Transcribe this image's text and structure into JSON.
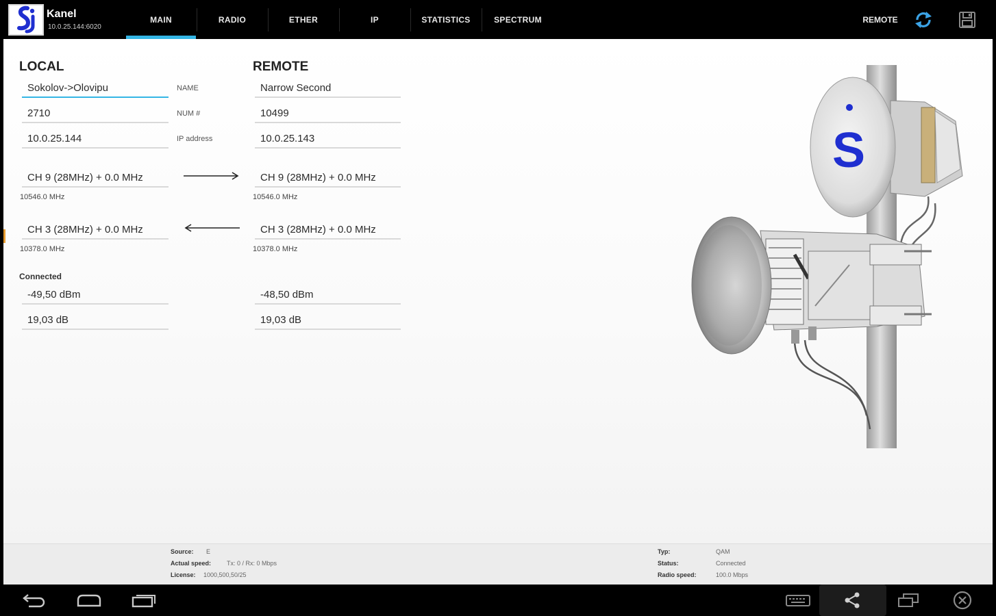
{
  "app": {
    "title": "Kanel",
    "subtitle": "10.0.25.144:6020"
  },
  "tabs": [
    "MAIN",
    "RADIO",
    "ETHER",
    "IP",
    "STATISTICS",
    "SPECTRUM"
  ],
  "active_tab": "MAIN",
  "actions": {
    "remote_label": "REMOTE",
    "icons": [
      "refresh-icon",
      "save-icon"
    ]
  },
  "local": {
    "heading": "LOCAL",
    "name": "Sokolov->Olovipu",
    "num": "2710",
    "ip": "10.0.25.144",
    "tx_channel": "CH 9 (28MHz) + 0.0 MHz",
    "tx_freq": "10546.0 MHz",
    "rx_channel": "CH 3 (28MHz) + 0.0 MHz",
    "rx_freq": "10378.0 MHz",
    "rssi": "-49,50 dBm",
    "snr": "19,03 dB"
  },
  "labels": {
    "name": "NAME",
    "num": "NUM #",
    "ip": "IP address",
    "connected": "Connected"
  },
  "remote": {
    "heading": "REMOTE",
    "name": "Narrow Second",
    "num": "10499",
    "ip": "10.0.25.143",
    "tx_channel": "CH 9 (28MHz) + 0.0 MHz",
    "tx_freq": "10546.0 MHz",
    "rx_channel": "CH 3 (28MHz) + 0.0 MHz",
    "rx_freq": "10378.0 MHz",
    "rssi": "-48,50 dBm",
    "snr": "19,03 dB"
  },
  "info_left": [
    {
      "key": "Source:",
      "value": "E"
    },
    {
      "key": "Actual speed:",
      "value": "Tx: 0 / Rx: 0 Mbps"
    },
    {
      "key": "License:",
      "value": "1000,500,50/25"
    }
  ],
  "info_right": [
    {
      "key": "Typ:",
      "value": "QAM"
    },
    {
      "key": "Status:",
      "value": "Connected"
    },
    {
      "key": "Radio speed:",
      "value": "100.0 Mbps"
    }
  ],
  "nav": [
    "back-icon",
    "home-icon",
    "recent-apps-icon",
    "keyboard-icon",
    "share-icon",
    "window-icon",
    "close-icon"
  ],
  "colors": {
    "accent": "#33b5e5",
    "logo_blue": "#1f2fd0",
    "bar": "#000000"
  }
}
